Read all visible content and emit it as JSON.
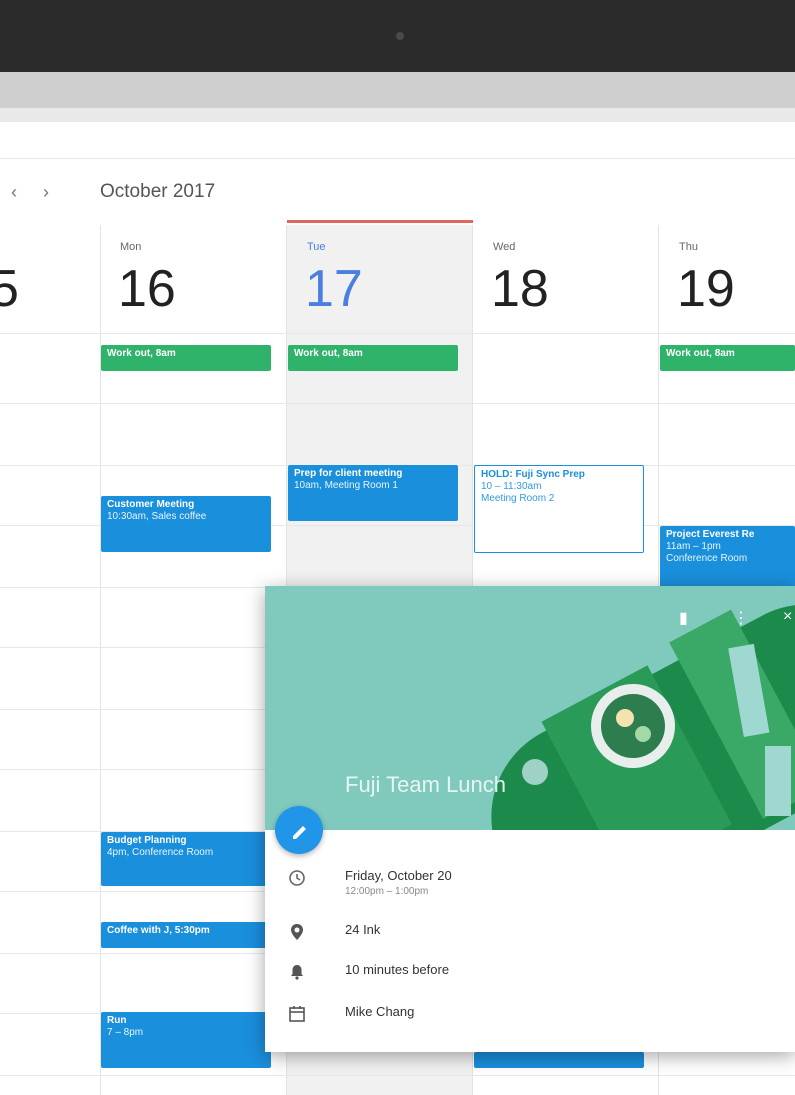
{
  "nav": {
    "prev": "‹",
    "next": "›",
    "month": "October 2017"
  },
  "days": [
    {
      "dow": "Mon",
      "num": "16"
    },
    {
      "dow": "Tue",
      "num": "17"
    },
    {
      "dow": "Wed",
      "num": "18"
    },
    {
      "dow": "Thu",
      "num": "19"
    }
  ],
  "partial_day": {
    "num": "5"
  },
  "events": {
    "mon_workout": {
      "title": "Work out, 8am"
    },
    "tue_workout": {
      "title": "Work out, 8am"
    },
    "thu_workout": {
      "title": "Work out, 8am"
    },
    "customer_meeting": {
      "title": "Customer Meeting",
      "sub": "10:30am, Sales coffee"
    },
    "prep_client": {
      "title": "Prep for client meeting",
      "sub": "10am, Meeting Room 1"
    },
    "hold_fuji": {
      "title": "HOLD: Fuji Sync Prep",
      "line2": "10 – 11:30am",
      "line3": "Meeting Room 2"
    },
    "project_review": {
      "title": "Project Everest Re",
      "line2": "11am – 1pm",
      "line3": "Conference Room"
    },
    "budget_planning": {
      "title": "Budget Planning",
      "sub": "4pm, Conference Room"
    },
    "coffee": {
      "title": "Coffee with J, 5:30pm"
    },
    "run": {
      "title": "Run",
      "sub": "7 – 8pm"
    }
  },
  "popup": {
    "title": "Fuji Team Lunch",
    "date": "Friday, October 20",
    "time": "12:00pm – 1:00pm",
    "location": "24 Ink",
    "reminder": "10 minutes before",
    "organizer": "Mike Chang"
  },
  "colors": {
    "event_blue": "#1a8fdc",
    "event_green": "#2fb36b",
    "today_accent": "#4a7fe0",
    "now_line": "#e0655c",
    "hero_bg": "#7fc9bd"
  }
}
